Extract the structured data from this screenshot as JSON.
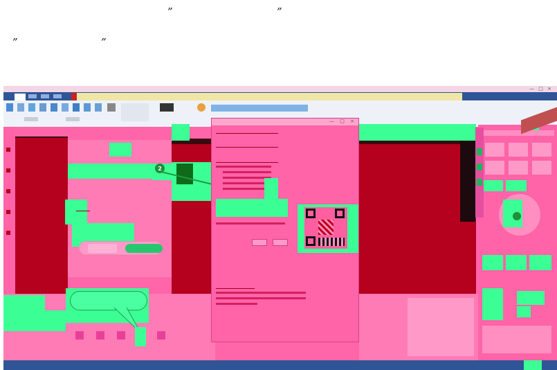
{
  "quotes": {
    "q1_open": "”",
    "q1_close": "”",
    "q2_open": "”",
    "q2_close": "”"
  },
  "window": {
    "title": "",
    "notification": "",
    "controls": {
      "minimize": "—",
      "maximize": "□",
      "close": "×"
    }
  },
  "ribbon": {
    "tabs": [
      "",
      "",
      "",
      ""
    ],
    "groups": [
      "",
      ""
    ]
  },
  "dialog": {
    "title": "",
    "controls": {
      "minimize": "—",
      "maximize": "□",
      "close": "×"
    },
    "sections": [
      "",
      "",
      "",
      "",
      ""
    ],
    "buttons": [
      "",
      ""
    ]
  },
  "left_panel": {
    "button_cancel": "",
    "button_ok": ""
  },
  "speech_bubble": {
    "text": ""
  },
  "step_marker": "2",
  "statusbar": {
    "left": "",
    "right": ""
  },
  "colors": {
    "accent": "#3bff95",
    "dark_region": "#b5001e",
    "overlay": "#ff66aa"
  }
}
